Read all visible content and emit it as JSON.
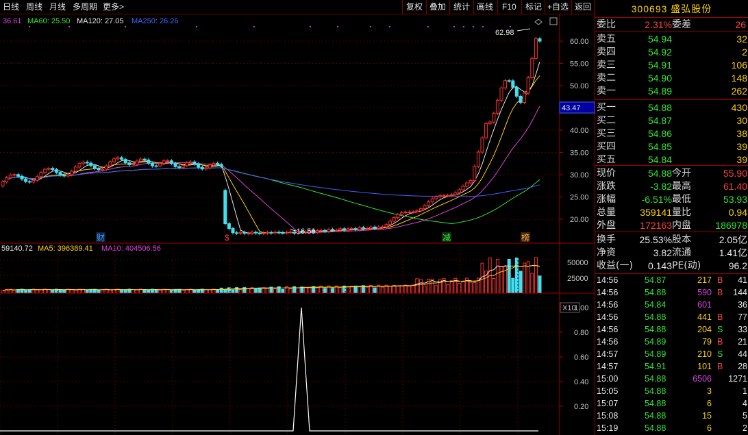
{
  "toolbar": {
    "left": [
      "日线",
      "周线",
      "月线",
      "多周期",
      "更多>"
    ],
    "right": [
      "复权",
      "叠加",
      "统计",
      "画线",
      "F10",
      "标记",
      "+自选",
      "返回"
    ]
  },
  "main_chart": {
    "ma_legend": [
      {
        "label": "36.61",
        "color": "#e040e0"
      },
      {
        "label": "MA60: 25.50",
        "color": "#32e632"
      },
      {
        "label": "MA120: 27.05",
        "color": "#e8e8e8"
      },
      {
        "label": "MA250: 26.26",
        "color": "#4060ff"
      }
    ],
    "y_ticks": [
      "60.00",
      "55.00",
      "50.00",
      "45.00",
      "40.00",
      "35.00",
      "30.00",
      "25.00",
      "20.00"
    ],
    "price_tag": "43.47",
    "high_label": "62.98",
    "low_label": "16.56",
    "event_marks": [
      {
        "text": "财",
        "color": "#40a0ff"
      },
      {
        "text": "$",
        "color": "#ff4040"
      },
      {
        "text": "减",
        "color": "#32e632"
      },
      {
        "text": "榜",
        "color": "#ffb040"
      }
    ]
  },
  "volume_chart": {
    "legend": [
      {
        "label": "59140.72",
        "color": "#e8e8e8"
      },
      {
        "label": "MA5: 396389.41",
        "color": "#ffd400"
      },
      {
        "label": "MA10: 404506.56",
        "color": "#e040e0"
      }
    ],
    "y_ticks": [
      "50000",
      "25000"
    ],
    "unit": "X10"
  },
  "indicator_chart": {
    "y_ticks": [
      "1.00",
      "0.80",
      "0.60",
      "0.40",
      "0.20"
    ]
  },
  "quote": {
    "title": "300693 盛弘股份",
    "weibi": {
      "label": "委比",
      "value": "2.31%",
      "diff_label": "委差",
      "diff": "26"
    },
    "asks": [
      {
        "label": "卖五",
        "price": "54.94",
        "vol": "32"
      },
      {
        "label": "卖四",
        "price": "54.92",
        "vol": "2"
      },
      {
        "label": "卖三",
        "price": "54.91",
        "vol": "106"
      },
      {
        "label": "卖二",
        "price": "54.90",
        "vol": "148"
      },
      {
        "label": "卖一",
        "price": "54.89",
        "vol": "262"
      }
    ],
    "bids": [
      {
        "label": "买一",
        "price": "54.88",
        "vol": "430"
      },
      {
        "label": "买二",
        "price": "54.87",
        "vol": "30"
      },
      {
        "label": "买三",
        "price": "54.86",
        "vol": "38"
      },
      {
        "label": "买四",
        "price": "54.85",
        "vol": "39"
      },
      {
        "label": "买五",
        "price": "54.84",
        "vol": "39"
      }
    ],
    "stats": [
      {
        "l1": "现价",
        "v1": "54.88",
        "c1": "grn",
        "l2": "今开",
        "v2": "55.90",
        "c2": "red"
      },
      {
        "l1": "涨跌",
        "v1": "-3.82",
        "c1": "grn",
        "l2": "最高",
        "v2": "61.40",
        "c2": "red"
      },
      {
        "l1": "涨幅",
        "v1": "-6.51%",
        "c1": "grn",
        "l2": "最低",
        "v2": "53.93",
        "c2": "grn"
      },
      {
        "l1": "总量",
        "v1": "359141",
        "c1": "yel",
        "l2": "量比",
        "v2": "0.94",
        "c2": "yel"
      },
      {
        "l1": "外盘",
        "v1": "172163",
        "c1": "red",
        "l2": "内盘",
        "v2": "186978",
        "c2": "grn"
      }
    ],
    "stats2": [
      {
        "l1": "换手",
        "v1": "25.53%",
        "l2": "股本",
        "v2": "2.05亿"
      },
      {
        "l1": "净资",
        "v1": "3.82",
        "l2": "流通",
        "v2": "1.41亿"
      },
      {
        "l1": "收益(一)",
        "v1": "0.143",
        "l2": "PE(动)",
        "v2": "96.2"
      }
    ],
    "trades": [
      {
        "time": "14:56",
        "price": "54.87",
        "vol": "217",
        "vc": "yel",
        "flag": "B",
        "fc": "red",
        "n": "41"
      },
      {
        "time": "14:56",
        "price": "54.88",
        "vol": "590",
        "vc": "mag",
        "flag": "B",
        "fc": "red",
        "n": "144"
      },
      {
        "time": "14:56",
        "price": "54.84",
        "vol": "601",
        "vc": "mag",
        "flag": "",
        "fc": "",
        "n": "36"
      },
      {
        "time": "14:56",
        "price": "54.88",
        "vol": "441",
        "vc": "yel",
        "flag": "B",
        "fc": "red",
        "n": "77"
      },
      {
        "time": "14:56",
        "price": "54.88",
        "vol": "204",
        "vc": "yel",
        "flag": "S",
        "fc": "grn",
        "n": "33"
      },
      {
        "time": "14:56",
        "price": "54.89",
        "vol": "79",
        "vc": "yel",
        "flag": "B",
        "fc": "red",
        "n": "21"
      },
      {
        "time": "14:57",
        "price": "54.89",
        "vol": "210",
        "vc": "yel",
        "flag": "S",
        "fc": "grn",
        "n": "44"
      },
      {
        "time": "14:57",
        "price": "54.91",
        "vol": "101",
        "vc": "yel",
        "flag": "B",
        "fc": "red",
        "n": "28"
      },
      {
        "time": "15:00",
        "price": "54.88",
        "vol": "6506",
        "vc": "mag",
        "flag": "",
        "fc": "",
        "n": "1271"
      },
      {
        "time": "15:05",
        "price": "54.88",
        "vol": "3",
        "vc": "yel",
        "flag": "",
        "fc": "",
        "n": "1"
      },
      {
        "time": "15:07",
        "price": "54.88",
        "vol": "6",
        "vc": "yel",
        "flag": "",
        "fc": "",
        "n": "4"
      },
      {
        "time": "15:08",
        "price": "54.88",
        "vol": "15",
        "vc": "yel",
        "flag": "",
        "fc": "",
        "n": "5"
      },
      {
        "time": "15:19",
        "price": "54.88",
        "vol": "6",
        "vc": "yel",
        "flag": "",
        "fc": "",
        "n": "2"
      }
    ]
  }
}
